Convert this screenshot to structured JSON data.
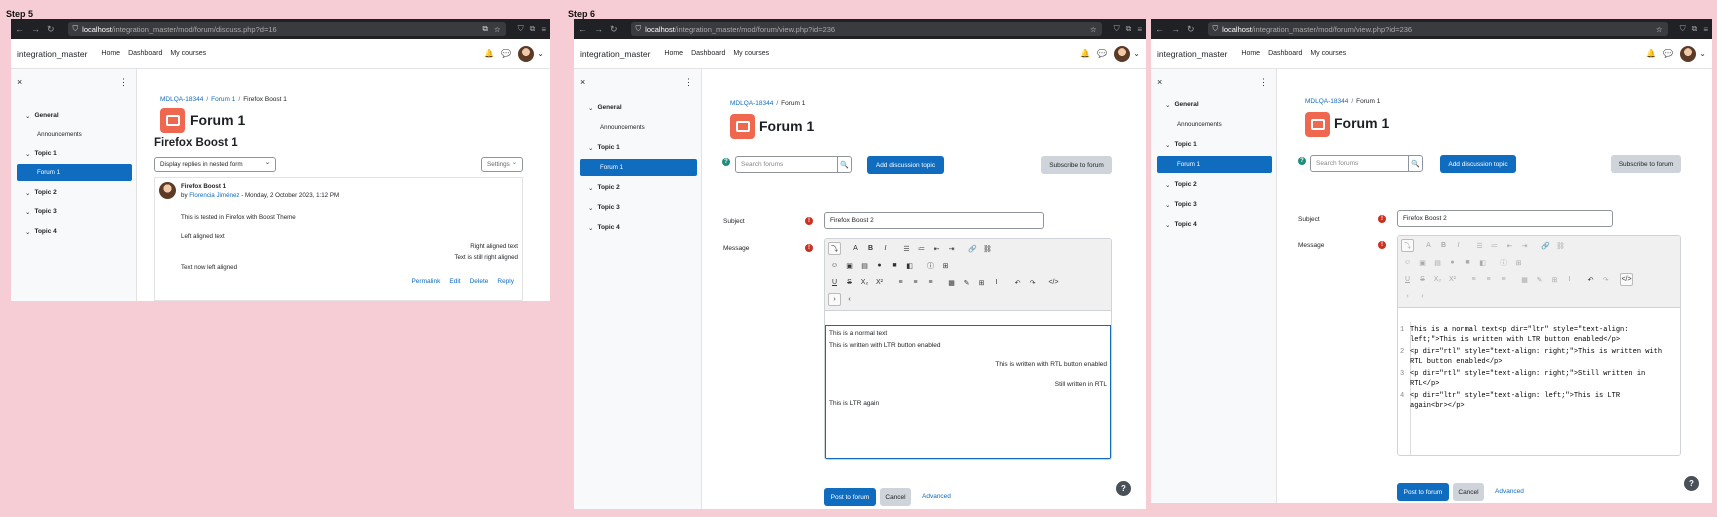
{
  "steps": [
    {
      "label": "Step 5"
    },
    {
      "label": "Step 6"
    }
  ],
  "common": {
    "site_name": "integration_master",
    "nav": [
      "Home",
      "Dashboard",
      "My courses"
    ],
    "drawer": {
      "close": "×",
      "more": "⋮",
      "sections": [
        "General",
        "Announcements",
        "Topic 1",
        "Forum 1",
        "Topic 2",
        "Topic 3",
        "Topic 4"
      ]
    },
    "page_title": "Forum 1",
    "host": "localhost",
    "icons": {
      "back": "←",
      "forward": "→",
      "reload": "↻",
      "shield": "⛉",
      "lock": "🔒",
      "star": "☆",
      "bell": "🔔",
      "chat": "💬",
      "ext": "⧉",
      "menu": "≡",
      "search": "🔍"
    }
  },
  "win1": {
    "url_path": "/integration_master/mod/forum/discuss.php?d=16",
    "breadcrumb": [
      "MDLQA-18344",
      "Forum 1",
      "Firefox Boost 1"
    ],
    "discussion_title": "Firefox Boost 1",
    "display_mode": "Display replies in nested form",
    "settings_label": "Settings",
    "post": {
      "subject": "Firefox Boost 1",
      "by": "by",
      "author": "Florencia Jiménez",
      "date": " - Monday, 2 October 2023, 1:12 PM",
      "lines": [
        "This is tested in Firefox with Boost Theme",
        "Left aligned text",
        "Right aligned text",
        "Text is still right aligned",
        "Text now left aligned"
      ],
      "actions": [
        "Permalink",
        "Edit",
        "Delete",
        "Reply"
      ]
    }
  },
  "win2": {
    "url_path": "/integration_master/mod/forum/view.php?id=236",
    "breadcrumb": [
      "MDLQA-18344",
      "Forum 1"
    ],
    "search_placeholder": "Search forums",
    "add_topic": "Add discussion topic",
    "subscribe": "Subscribe to forum",
    "subject_label": "Subject",
    "subject_value": "Firefox Boost 2",
    "message_label": "Message",
    "content_lines": [
      "This is a normal text",
      "This is written with LTR button enabled",
      "This is written with RTL button enabled",
      "Still written in RTL",
      "This is LTR again"
    ],
    "post_btn": "Post to forum",
    "cancel_btn": "Cancel",
    "advanced": "Advanced",
    "help": "?"
  },
  "win3": {
    "url_path": "/integration_master/mod/forum/view.php?id=236",
    "breadcrumb": [
      "MDLQA-18344",
      "Forum 1"
    ],
    "search_placeholder": "Search forums",
    "add_topic": "Add discussion topic",
    "subscribe": "Subscribe to forum",
    "subject_label": "Subject",
    "subject_value": "Firefox Boost 2",
    "message_label": "Message",
    "html_lines": [
      {
        "num": "1",
        "l1": "This is a normal text<p dir=\"ltr\" style=\"text-align:",
        "l2": "left;\">This is written with LTR button enabled</p>"
      },
      {
        "num": "2",
        "l1": "<p dir=\"rtl\" style=\"text-align: right;\">This is written with",
        "l2": "RTL button enabled</p>"
      },
      {
        "num": "3",
        "l1": "<p dir=\"rtl\" style=\"text-align: right;\">Still written in",
        "l2": "RTL</p>"
      },
      {
        "num": "4",
        "l1": "<p dir=\"ltr\" style=\"text-align: left;\">This is LTR",
        "l2": "again<br></p>"
      }
    ],
    "post_btn": "Post to forum",
    "cancel_btn": "Cancel",
    "advanced": "Advanced",
    "help": "?"
  }
}
